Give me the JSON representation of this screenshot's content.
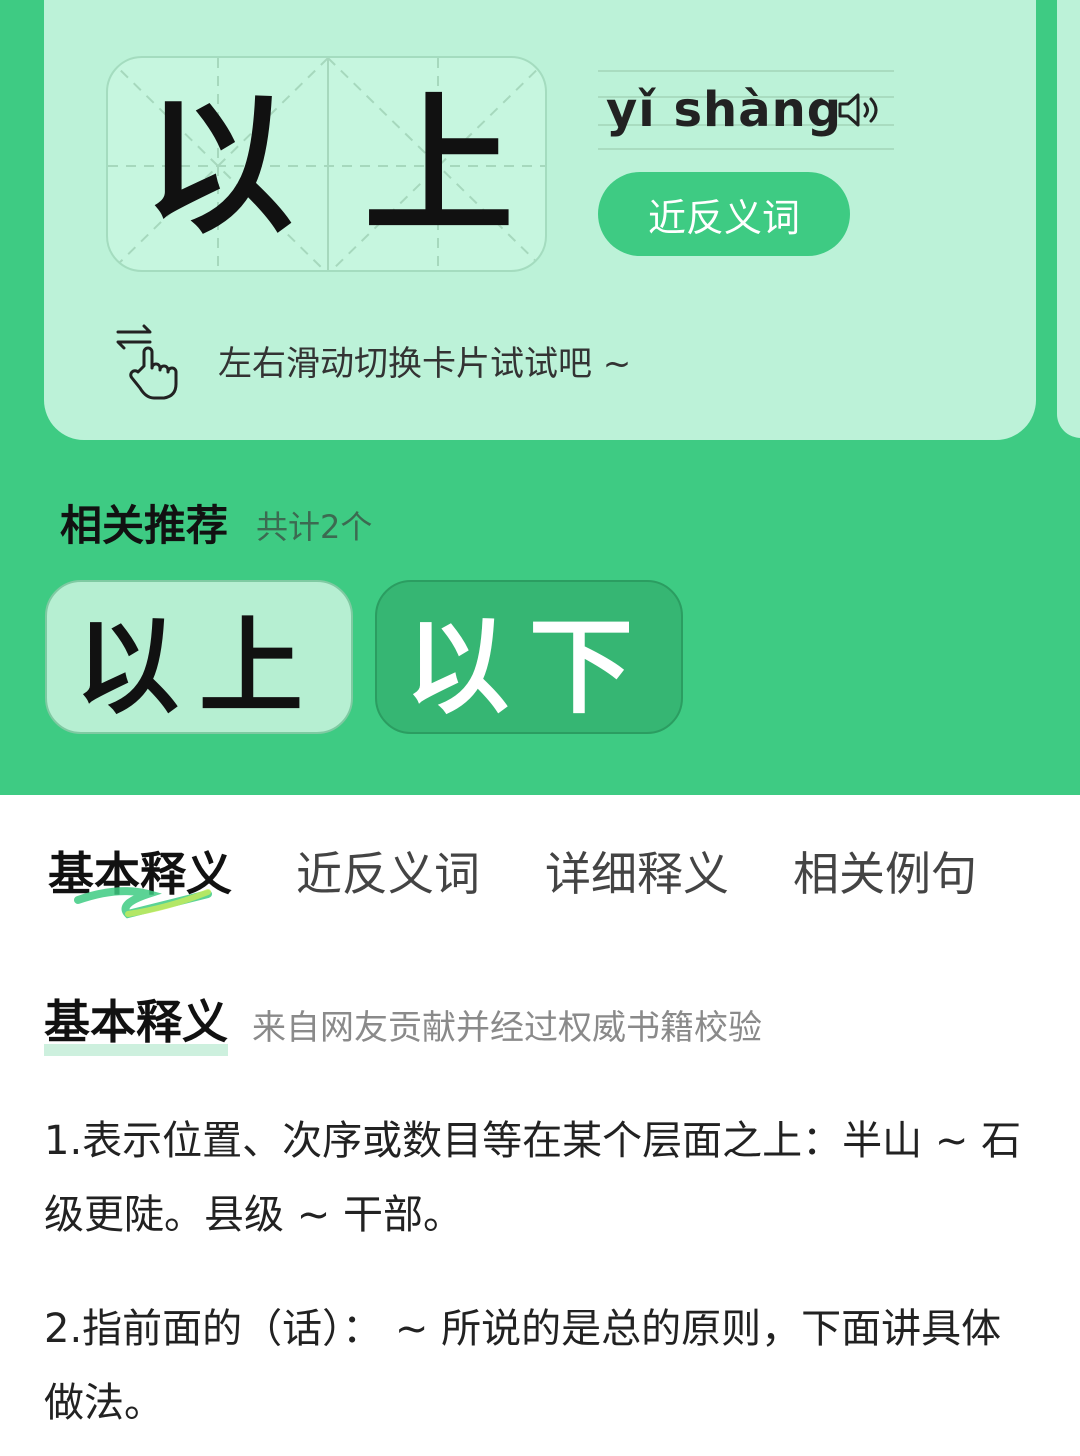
{
  "word": {
    "chars": [
      "以",
      "上"
    ],
    "pinyin": "yǐ shàng",
    "synonym_button": "近反义词",
    "swipe_hint": "左右滑动切换卡片试试吧 ~"
  },
  "recommend": {
    "title": "相关推荐",
    "count": "共计2个",
    "items": [
      {
        "label": "以上"
      },
      {
        "label": "以下"
      }
    ]
  },
  "tabs": [
    {
      "label": "基本释义",
      "active": true
    },
    {
      "label": "近反义词",
      "active": false
    },
    {
      "label": "详细释义",
      "active": false
    },
    {
      "label": "相关例句",
      "active": false
    }
  ],
  "basic": {
    "title": "基本释义",
    "subtitle": "来自网友贡献并经过权威书籍校验",
    "definitions": [
      "1.表示位置、次序或数目等在某个层面之上：半山 ~ 石级更陡。县级 ~ 干部。",
      "2.指前面的（话）： ~ 所说的是总的原则，下面讲具体做法。"
    ]
  },
  "colors": {
    "primary_green": "#3ecb83",
    "card_mint": "#bcf2d8",
    "dark_green_card": "#36b673"
  }
}
